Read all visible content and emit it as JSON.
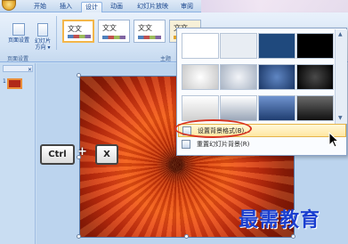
{
  "tabs": [
    {
      "label": "开始"
    },
    {
      "label": "插入"
    },
    {
      "label": "设计"
    },
    {
      "label": "动画"
    },
    {
      "label": "幻灯片放映"
    },
    {
      "label": "审阅"
    }
  ],
  "ribbon": {
    "page_setup_label": "页面设置",
    "orientation_label_line1": "幻灯片",
    "orientation_label_line2": "方向",
    "group_page_setup": "页面设置",
    "group_themes": "主题",
    "theme_text": "文文"
  },
  "dropdown": {
    "menu_items": [
      {
        "label": "设置背景格式(B)..."
      },
      {
        "label": "重置幻灯片背景(R)"
      }
    ]
  },
  "keys": {
    "ctrl": "Ctrl",
    "x": "X",
    "plus": "+"
  },
  "slide_panel": {
    "thumb_number": "1"
  },
  "watermark": "最需教育"
}
